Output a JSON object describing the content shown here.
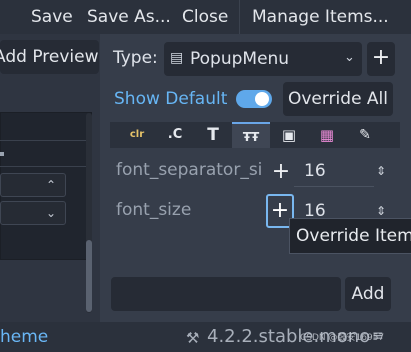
{
  "menu": {
    "save": "Save",
    "save_as": "Save As...",
    "close": "Close",
    "manage_items": "Manage Items..."
  },
  "left": {
    "add_preview": "Add Preview",
    "theme_link": "heme"
  },
  "type_row": {
    "label": "Type:",
    "value": "PopupMenu",
    "add": "+"
  },
  "show_default": {
    "label": "Show Default",
    "enabled": true,
    "override_all": "Override All"
  },
  "tabs": [
    {
      "label": "clr",
      "icon": "color-tab-icon"
    },
    {
      "label": ".C",
      "icon": "constant-tab-icon"
    },
    {
      "label": "T",
      "icon": "font-tab-icon"
    },
    {
      "label": "ŦŦ",
      "icon": "font-size-tab-icon"
    },
    {
      "label": "▣",
      "icon": "icon-tab-icon"
    },
    {
      "label": "▦",
      "icon": "stylebox-tab-icon"
    },
    {
      "label": "✎",
      "icon": "tools-icon"
    }
  ],
  "properties": [
    {
      "name": "font_separator_si",
      "override": "+",
      "value": "16"
    },
    {
      "name": "font_size",
      "override": "+",
      "value": "16"
    }
  ],
  "tooltip": "Override Item",
  "add_button": "Add",
  "status": {
    "version": "4.2.2.stable.mono",
    "watermark": "CSDN @鼓安16957"
  },
  "colors": {
    "accent": "#67b6f5",
    "panel": "#363d4a",
    "button": "#262b35"
  }
}
